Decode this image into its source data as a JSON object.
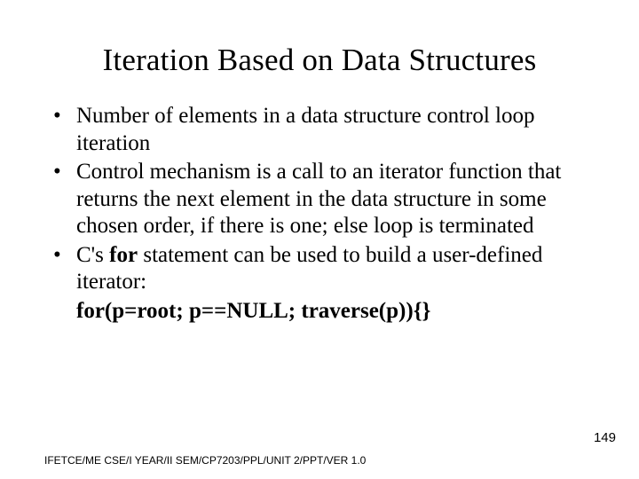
{
  "title": "Iteration Based on Data Structures",
  "bullets": [
    "Number of elements in a data structure control loop iteration",
    "Control mechanism is a call to an iterator function that returns the next element in the data structure in some chosen order, if there is one; else loop is terminated"
  ],
  "bullet3_prefix": "C's ",
  "bullet3_bold": "for",
  "bullet3_suffix": " statement can be used to build a user-defined iterator:",
  "code_line": "for(p=root; p==NULL; traverse(p)){}",
  "footer": "IFETCE/ME CSE/I YEAR/II SEM/CP7203/PPL/UNIT 2/PPT/VER 1.0",
  "page_number": "149"
}
